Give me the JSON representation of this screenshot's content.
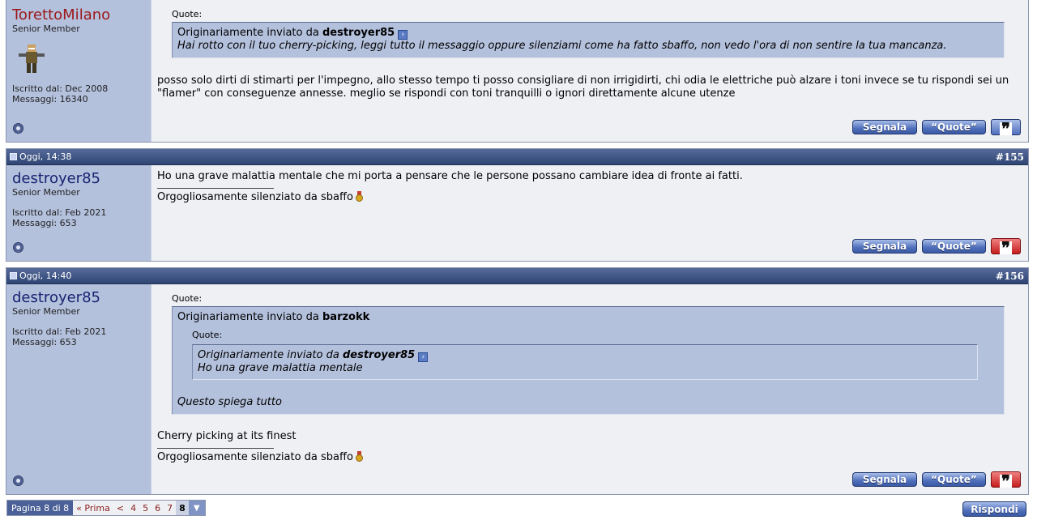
{
  "posts": [
    {
      "username": "TorettoMilano",
      "usertitle": "Senior Member",
      "joined": "Iscritto dal: Dec 2008",
      "messages": "Messaggi: 16340",
      "quote_label": "Quote:",
      "quote_prefix": "Originariamente inviato da",
      "quote_author": "destroyer85",
      "quote_text": "Hai rotto con il tuo cherry-picking, leggi tutto il messaggio oppure silenziami come ha fatto sbaffo, non vedo l'ora di non sentire la tua mancanza.",
      "body": "posso solo dirti di stimarti per l'impegno, allo stesso tempo ti posso consigliare di non irrigidirti, chi odia le elettriche può alzare i toni invece se tu rispondi sei un \"flamer\" con conseguenze annesse. meglio se rispondi con toni tranquilli o ignori direttamente alcune utenze"
    },
    {
      "date": "Oggi, 14:38",
      "postnum": "#155",
      "username": "destroyer85",
      "usertitle": "Senior Member",
      "joined": "Iscritto dal: Feb 2021",
      "messages": "Messaggi: 653",
      "body": "Ho una grave malattia mentale che mi porta a pensare che le persone possano cambiare idea di fronte ai fatti.",
      "signature": "Orgogliosamente silenziato da sbaffo"
    },
    {
      "date": "Oggi, 14:40",
      "postnum": "#156",
      "username": "destroyer85",
      "usertitle": "Senior Member",
      "joined": "Iscritto dal: Feb 2021",
      "messages": "Messaggi: 653",
      "quote_label": "Quote:",
      "quote_prefix": "Originariamente inviato da",
      "quote_author": "barzokk",
      "inner_quote_label": "Quote:",
      "inner_quote_prefix": "Originariamente inviato da",
      "inner_quote_author": "destroyer85",
      "inner_quote_text": "Ho una grave malattia mentale",
      "quote_text": "Questo spiega tutto",
      "body": "Cherry picking at its finest",
      "signature": "Orgogliosamente silenziato da sbaffo"
    }
  ],
  "buttons": {
    "report": "Segnala",
    "quote": "“Quote”",
    "multiquote": "❞"
  },
  "pagination": {
    "info": "Pagina 8 di 8",
    "first": "« Prima",
    "prev": "<",
    "pages": [
      "4",
      "5",
      "6",
      "7",
      "8"
    ],
    "current": "8"
  },
  "reply_button": "Rispondi"
}
